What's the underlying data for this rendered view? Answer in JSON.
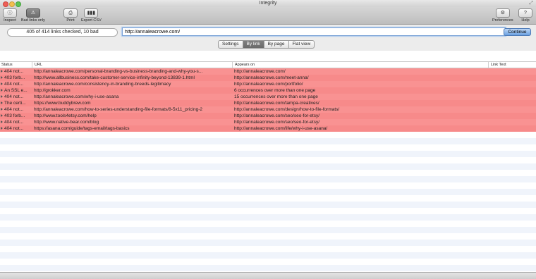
{
  "window": {
    "title": "Integrity"
  },
  "toolbar": {
    "inspect_label": "Inspect",
    "bad_links_label": "Bad links only",
    "print_label": "Print",
    "export_label": "Export CSV",
    "preferences_label": "Preferences",
    "help_label": "Help"
  },
  "scan": {
    "status": "405 of 414 links checked, 10 bad",
    "url_value": "http://annaleacrowe.com/",
    "continue_label": "Continue"
  },
  "tabs": [
    {
      "label": "Settings",
      "active": false
    },
    {
      "label": "By link",
      "active": true
    },
    {
      "label": "By page",
      "active": false
    },
    {
      "label": "Flat view",
      "active": false
    }
  ],
  "table": {
    "columns": {
      "status": "Status",
      "url": "URL",
      "appears_on": "Appears on",
      "link_text": "Link Text"
    },
    "rows": [
      {
        "status": "404 not...",
        "url": "http://annaleacrowe.com/personal-branding-vs-business-branding-and-why-you-s...",
        "appears_on": "http://annaleacrowe.com/",
        "link_text": ""
      },
      {
        "status": "403 forb...",
        "url": "http://www.allbusiness.com/take-customer-service-infinity-beyond-13839-1.html",
        "appears_on": "http://annaleacrowe.com/meet-anna/",
        "link_text": ""
      },
      {
        "status": "404 not...",
        "url": "http://annaleacrowe.com/consistency-in-branding-breeds-legitimacy",
        "appears_on": "http://annaleacrowe.com/portfolio/",
        "link_text": ""
      },
      {
        "status": "An SSL e...",
        "url": "http://grokker.com",
        "appears_on": "6 occurrences over more than one page",
        "link_text": ""
      },
      {
        "status": "404 not...",
        "url": "http://annaleacrowe.com/why-i-use-asana",
        "appears_on": "15 occurrences over more than one page",
        "link_text": ""
      },
      {
        "status": "The certi...",
        "url": "https://www.buddybrew.com",
        "appears_on": "http://annaleacrowe.com/tampa-creatives/",
        "link_text": ""
      },
      {
        "status": "404 not...",
        "url": "http://annaleacrowe.com/how-to-series-understanding-file-formats/8-5x11_pricing-2",
        "appears_on": "http://annaleacrowe.com/design/how-to-file-formats/",
        "link_text": ""
      },
      {
        "status": "403 forb...",
        "url": "http://www.tools4etsy.com/help",
        "appears_on": "http://annaleacrowe.com/seo/seo-for-etsy/",
        "link_text": ""
      },
      {
        "status": "404 not...",
        "url": "http://www.native-bear.com/blog",
        "appears_on": "http://annaleacrowe.com/seo/seo-for-etsy/",
        "link_text": ""
      },
      {
        "status": "404 not...",
        "url": "https://asana.com/guide/tags-email/tags-basics",
        "appears_on": "http://annaleacrowe.com/life/why-i-use-asana/",
        "link_text": ""
      }
    ]
  },
  "colors": {
    "bad_row": "#f99292",
    "accent": "#6aa0e0",
    "stripe": "#f0f4fb"
  },
  "icons": [
    "inspect-icon",
    "bad-links-icon",
    "print-icon",
    "export-csv-icon",
    "preferences-icon",
    "help-icon"
  ]
}
